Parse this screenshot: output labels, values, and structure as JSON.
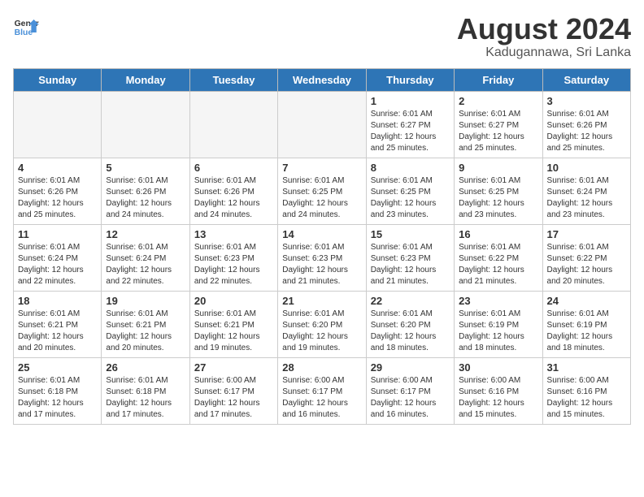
{
  "header": {
    "logo_line1": "General",
    "logo_line2": "Blue",
    "month_title": "August 2024",
    "location": "Kadugannawa, Sri Lanka"
  },
  "weekdays": [
    "Sunday",
    "Monday",
    "Tuesday",
    "Wednesday",
    "Thursday",
    "Friday",
    "Saturday"
  ],
  "weeks": [
    [
      {
        "day": "",
        "info": ""
      },
      {
        "day": "",
        "info": ""
      },
      {
        "day": "",
        "info": ""
      },
      {
        "day": "",
        "info": ""
      },
      {
        "day": "1",
        "info": "Sunrise: 6:01 AM\nSunset: 6:27 PM\nDaylight: 12 hours\nand 25 minutes."
      },
      {
        "day": "2",
        "info": "Sunrise: 6:01 AM\nSunset: 6:27 PM\nDaylight: 12 hours\nand 25 minutes."
      },
      {
        "day": "3",
        "info": "Sunrise: 6:01 AM\nSunset: 6:26 PM\nDaylight: 12 hours\nand 25 minutes."
      }
    ],
    [
      {
        "day": "4",
        "info": "Sunrise: 6:01 AM\nSunset: 6:26 PM\nDaylight: 12 hours\nand 25 minutes."
      },
      {
        "day": "5",
        "info": "Sunrise: 6:01 AM\nSunset: 6:26 PM\nDaylight: 12 hours\nand 24 minutes."
      },
      {
        "day": "6",
        "info": "Sunrise: 6:01 AM\nSunset: 6:26 PM\nDaylight: 12 hours\nand 24 minutes."
      },
      {
        "day": "7",
        "info": "Sunrise: 6:01 AM\nSunset: 6:25 PM\nDaylight: 12 hours\nand 24 minutes."
      },
      {
        "day": "8",
        "info": "Sunrise: 6:01 AM\nSunset: 6:25 PM\nDaylight: 12 hours\nand 23 minutes."
      },
      {
        "day": "9",
        "info": "Sunrise: 6:01 AM\nSunset: 6:25 PM\nDaylight: 12 hours\nand 23 minutes."
      },
      {
        "day": "10",
        "info": "Sunrise: 6:01 AM\nSunset: 6:24 PM\nDaylight: 12 hours\nand 23 minutes."
      }
    ],
    [
      {
        "day": "11",
        "info": "Sunrise: 6:01 AM\nSunset: 6:24 PM\nDaylight: 12 hours\nand 22 minutes."
      },
      {
        "day": "12",
        "info": "Sunrise: 6:01 AM\nSunset: 6:24 PM\nDaylight: 12 hours\nand 22 minutes."
      },
      {
        "day": "13",
        "info": "Sunrise: 6:01 AM\nSunset: 6:23 PM\nDaylight: 12 hours\nand 22 minutes."
      },
      {
        "day": "14",
        "info": "Sunrise: 6:01 AM\nSunset: 6:23 PM\nDaylight: 12 hours\nand 21 minutes."
      },
      {
        "day": "15",
        "info": "Sunrise: 6:01 AM\nSunset: 6:23 PM\nDaylight: 12 hours\nand 21 minutes."
      },
      {
        "day": "16",
        "info": "Sunrise: 6:01 AM\nSunset: 6:22 PM\nDaylight: 12 hours\nand 21 minutes."
      },
      {
        "day": "17",
        "info": "Sunrise: 6:01 AM\nSunset: 6:22 PM\nDaylight: 12 hours\nand 20 minutes."
      }
    ],
    [
      {
        "day": "18",
        "info": "Sunrise: 6:01 AM\nSunset: 6:21 PM\nDaylight: 12 hours\nand 20 minutes."
      },
      {
        "day": "19",
        "info": "Sunrise: 6:01 AM\nSunset: 6:21 PM\nDaylight: 12 hours\nand 20 minutes."
      },
      {
        "day": "20",
        "info": "Sunrise: 6:01 AM\nSunset: 6:21 PM\nDaylight: 12 hours\nand 19 minutes."
      },
      {
        "day": "21",
        "info": "Sunrise: 6:01 AM\nSunset: 6:20 PM\nDaylight: 12 hours\nand 19 minutes."
      },
      {
        "day": "22",
        "info": "Sunrise: 6:01 AM\nSunset: 6:20 PM\nDaylight: 12 hours\nand 18 minutes."
      },
      {
        "day": "23",
        "info": "Sunrise: 6:01 AM\nSunset: 6:19 PM\nDaylight: 12 hours\nand 18 minutes."
      },
      {
        "day": "24",
        "info": "Sunrise: 6:01 AM\nSunset: 6:19 PM\nDaylight: 12 hours\nand 18 minutes."
      }
    ],
    [
      {
        "day": "25",
        "info": "Sunrise: 6:01 AM\nSunset: 6:18 PM\nDaylight: 12 hours\nand 17 minutes."
      },
      {
        "day": "26",
        "info": "Sunrise: 6:01 AM\nSunset: 6:18 PM\nDaylight: 12 hours\nand 17 minutes."
      },
      {
        "day": "27",
        "info": "Sunrise: 6:00 AM\nSunset: 6:17 PM\nDaylight: 12 hours\nand 17 minutes."
      },
      {
        "day": "28",
        "info": "Sunrise: 6:00 AM\nSunset: 6:17 PM\nDaylight: 12 hours\nand 16 minutes."
      },
      {
        "day": "29",
        "info": "Sunrise: 6:00 AM\nSunset: 6:17 PM\nDaylight: 12 hours\nand 16 minutes."
      },
      {
        "day": "30",
        "info": "Sunrise: 6:00 AM\nSunset: 6:16 PM\nDaylight: 12 hours\nand 15 minutes."
      },
      {
        "day": "31",
        "info": "Sunrise: 6:00 AM\nSunset: 6:16 PM\nDaylight: 12 hours\nand 15 minutes."
      }
    ]
  ]
}
